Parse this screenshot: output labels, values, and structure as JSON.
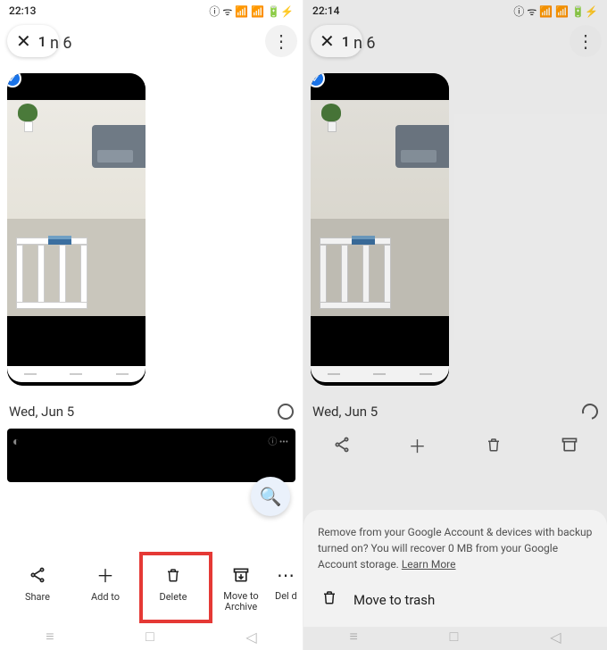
{
  "left": {
    "status": {
      "time": "22:13",
      "icons": "ⓘ ᯤ 📶 📶 🔋⚡"
    },
    "header": {
      "count": "1",
      "date_partial": "n 6"
    },
    "date2": "Wed, Jun 5",
    "actions": {
      "share": "Share",
      "addto": "Add to",
      "delete": "Delete",
      "moveto": "Move to Archive",
      "partial_label": "Del d"
    },
    "zoom_aria": "zoom"
  },
  "right": {
    "status": {
      "time": "22:14",
      "icons": "ⓘ ᯤ 📶 📶 🔋⚡"
    },
    "header": {
      "count": "1",
      "date_partial": "n 6"
    },
    "date2": "Wed, Jun 5",
    "confirm": {
      "text": "Remove from your Google Account & devices with backup turned on? You will recover 0 MB from your Google Account storage. ",
      "learn_more": "Learn More",
      "move_to_trash": "Move to trash"
    }
  }
}
